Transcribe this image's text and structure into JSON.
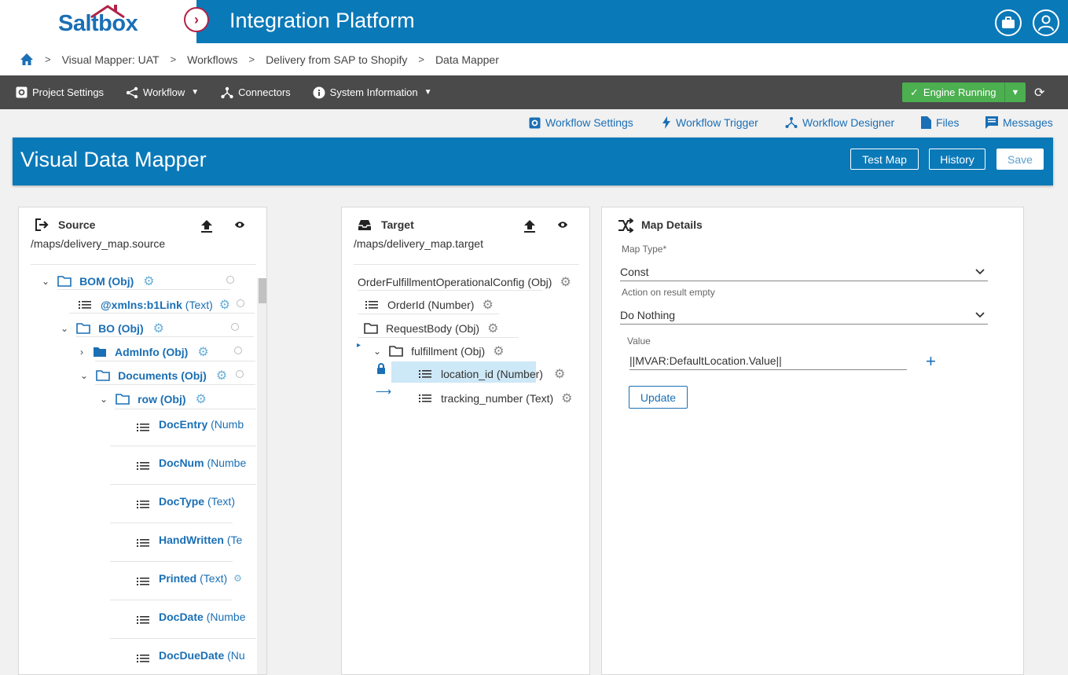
{
  "header": {
    "logo": "Saltbox",
    "title": "Integration Platform"
  },
  "breadcrumb": [
    "Visual Mapper: UAT",
    "Workflows",
    "Delivery from SAP to Shopify",
    "Data Mapper"
  ],
  "toolbar": {
    "project_settings": "Project Settings",
    "workflow": "Workflow",
    "connectors": "Connectors",
    "system_information": "System Information",
    "engine_status": "Engine Running"
  },
  "sublinks": {
    "workflow_settings": "Workflow Settings",
    "workflow_trigger": "Workflow Trigger",
    "workflow_designer": "Workflow Designer",
    "files": "Files",
    "messages": "Messages"
  },
  "mapper": {
    "title": "Visual Data Mapper",
    "test_map": "Test Map",
    "history": "History",
    "save": "Save"
  },
  "source": {
    "title": "Source",
    "path": "/maps/delivery_map.source",
    "nodes": [
      {
        "label": "BOM",
        "type": "(Obj)"
      },
      {
        "label": "@xmlns:b1Link",
        "type": "(Text)"
      },
      {
        "label": "BO",
        "type": "(Obj)"
      },
      {
        "label": "AdmInfo",
        "type": "(Obj)"
      },
      {
        "label": "Documents",
        "type": "(Obj)"
      },
      {
        "label": "row",
        "type": "(Obj)"
      },
      {
        "label": "DocEntry",
        "type": "(Numb"
      },
      {
        "label": "DocNum",
        "type": "(Numbe"
      },
      {
        "label": "DocType",
        "type": "(Text)"
      },
      {
        "label": "HandWritten",
        "type": "(Te"
      },
      {
        "label": "Printed",
        "type": "(Text)"
      },
      {
        "label": "DocDate",
        "type": "(Numbe"
      },
      {
        "label": "DocDueDate",
        "type": "(Nu"
      }
    ]
  },
  "target": {
    "title": "Target",
    "path": "/maps/delivery_map.target",
    "nodes": [
      {
        "label": "OrderFulfillmentOperationalConfig (Obj)"
      },
      {
        "label": "OrderId (Number)"
      },
      {
        "label": "RequestBody (Obj)"
      },
      {
        "label": "fulfillment (Obj)"
      },
      {
        "label": "location_id (Number)"
      },
      {
        "label": "tracking_number (Text)"
      }
    ]
  },
  "map_details": {
    "title": "Map Details",
    "map_type_label": "Map Type*",
    "map_type_value": "Const",
    "action_label": "Action on result empty",
    "action_value": "Do Nothing",
    "value_label": "Value",
    "value": "||MVAR:DefaultLocation.Value||",
    "update": "Update"
  }
}
